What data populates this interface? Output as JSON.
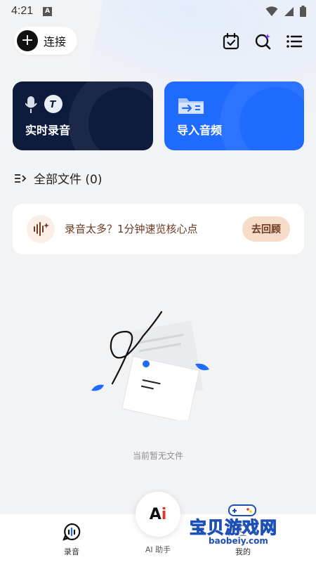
{
  "status": {
    "time": "4:21",
    "notif": "A"
  },
  "header": {
    "connect_label": "连接"
  },
  "cards": {
    "record_label": "实时录音",
    "import_label": "导入音频"
  },
  "files": {
    "header_label": "全部文件 (0)"
  },
  "banner": {
    "text": "录音太多？1分钟速览核心点",
    "button": "去回顾"
  },
  "empty": {
    "text": "当前暂无文件"
  },
  "nav": {
    "record_label": "录音",
    "ai_label": "AI 助手",
    "mine_label": "我的"
  },
  "watermark": {
    "title": "宝贝游戏网",
    "url": "baobeiy.com"
  },
  "colors": {
    "accent": "#1f6bff",
    "dark_card": "#0d1b3d",
    "banner_text": "#6a3b22"
  }
}
